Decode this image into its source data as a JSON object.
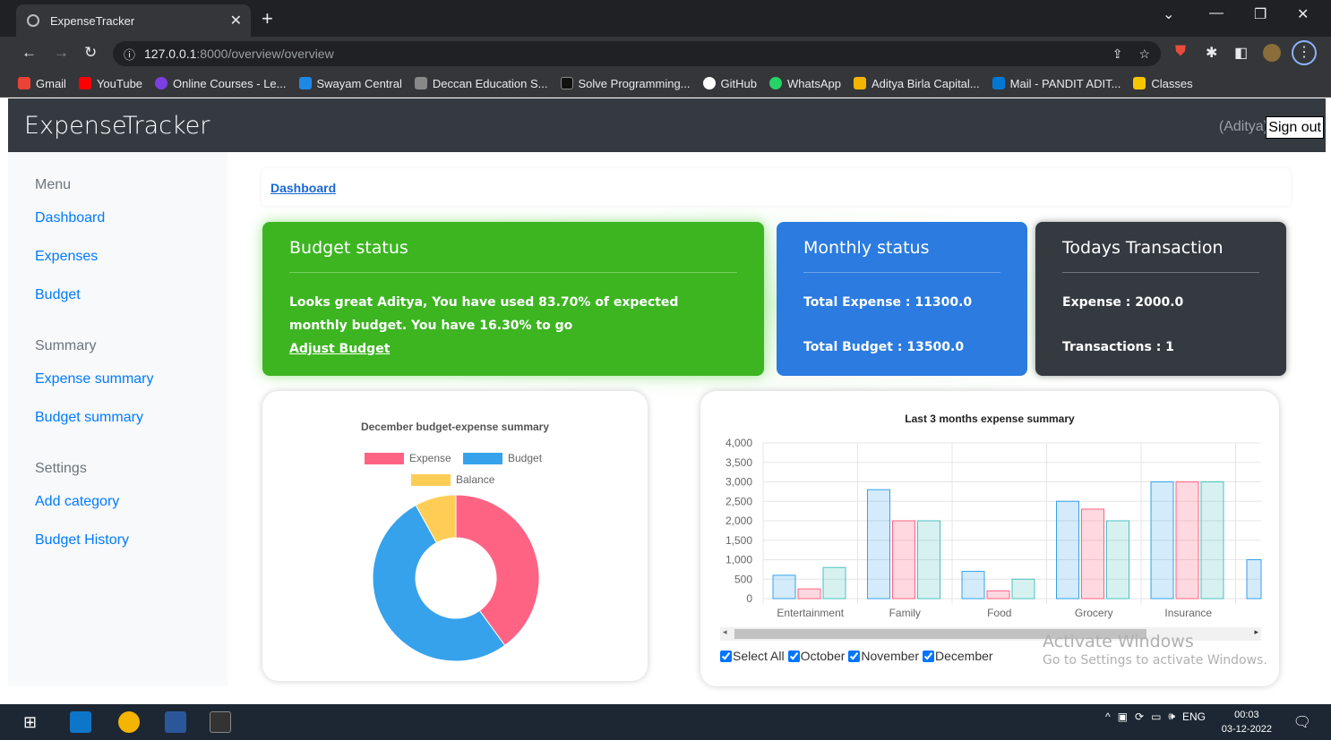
{
  "browser": {
    "tab_title": "ExpenseTracker",
    "url_host": "127.0.0.1",
    "url_path": ":8000/overview/overview",
    "bookmarks": [
      "Gmail",
      "YouTube",
      "Online Courses - Le...",
      "Swayam Central",
      "Deccan Education S...",
      "Solve Programming...",
      "GitHub",
      "WhatsApp",
      "Aditya Birla Capital...",
      "Mail - PANDIT ADIT...",
      "Classes"
    ]
  },
  "navbar": {
    "brand": "ExpenseTracker",
    "user": "(Aditya)",
    "signout": "Sign out"
  },
  "sidebar": {
    "menu_heading": "Menu",
    "menu_items": [
      "Dashboard",
      "Expenses",
      "Budget"
    ],
    "summary_heading": "Summary",
    "summary_items": [
      "Expense summary",
      "Budget summary"
    ],
    "settings_heading": "Settings",
    "settings_items": [
      "Add category",
      "Budget History"
    ]
  },
  "breadcrumb": "Dashboard",
  "cards": {
    "budget_status": {
      "title": "Budget status",
      "text": "Looks great Aditya, You have used 83.70% of expected monthly budget. You have 16.30% to go",
      "link": "Adjust Budget"
    },
    "monthly_status": {
      "title": "Monthly status",
      "expense": "Total Expense : 11300.0",
      "budget": "Total Budget : 13500.0"
    },
    "todays_transaction": {
      "title": "Todays Transaction",
      "expense": "Expense : 2000.0",
      "transactions": "Transactions : 1"
    }
  },
  "chart_data": [
    {
      "type": "pie",
      "title": "December budget-expense summary",
      "labels": [
        "Expense",
        "Budget",
        "Balance"
      ],
      "values": [
        2000,
        2600,
        400
      ],
      "colors": [
        "#ff6384",
        "#36a2eb",
        "#ffcd56"
      ],
      "donut": true,
      "legend": "top"
    },
    {
      "type": "bar",
      "title": "Last 3 months expense summary",
      "categories": [
        "Entertainment",
        "Family",
        "Food",
        "Grocery",
        "Insurance"
      ],
      "series": [
        {
          "name": "October",
          "values": [
            600,
            2800,
            700,
            2500,
            3000
          ],
          "color": "#36a2eb"
        },
        {
          "name": "November",
          "values": [
            250,
            2000,
            200,
            2300,
            3000
          ],
          "color": "#ff6384"
        },
        {
          "name": "December",
          "values": [
            800,
            2000,
            500,
            2000,
            3000
          ],
          "color": "#4bc0c0"
        }
      ],
      "ylim": [
        0,
        4000
      ],
      "yticks": [
        "4,000",
        "3,500",
        "3,000",
        "2,500",
        "2,000",
        "1,500",
        "1,000",
        "500",
        "0"
      ],
      "grid": true
    }
  ],
  "filters": [
    "Select All",
    "October",
    "November",
    "December"
  ],
  "watermark": {
    "line1": "Activate Windows",
    "line2": "Go to Settings to activate Windows."
  },
  "taskbar": {
    "time": "00:03",
    "date": "03-12-2022",
    "lang": "ENG"
  }
}
